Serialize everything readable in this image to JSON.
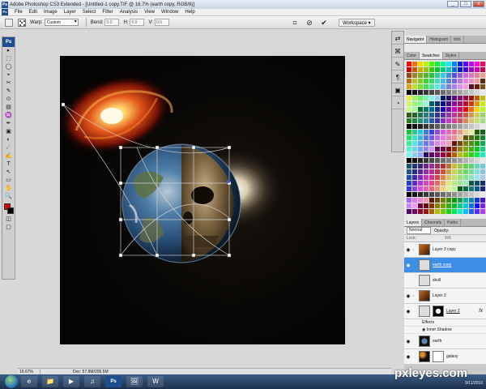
{
  "window": {
    "title": "Adobe Photoshop CS3 Extended - [Untitled-1 copy.TIF @ 16.7% (earth copy, RGB/8)]",
    "minimize": "_",
    "maximize": "□",
    "close": "x"
  },
  "app_logo": "Ps",
  "menu": [
    "File",
    "Edit",
    "Image",
    "Layer",
    "Select",
    "Filter",
    "Analysis",
    "View",
    "Window",
    "Help"
  ],
  "options": {
    "warp_label": "Warp:",
    "warp_value": "Custom",
    "bend_label": "Bend:",
    "bend_value": "0.0",
    "h_label": "H:",
    "h_value": "0.0",
    "v_label": "V:",
    "v_value": "0.0",
    "workspace": "Workspace ▾"
  },
  "tools_head": "Ps",
  "tools": [
    "▸",
    "⬚",
    "◯",
    "⌖",
    "✂",
    "✎",
    "⊙",
    "▤",
    "♒",
    "✒",
    "▣",
    "◐",
    "☄",
    "✍",
    "T",
    "↖",
    "▭",
    "✋",
    "🔍"
  ],
  "status": {
    "zoom": "16.67%",
    "doc": "Doc: 57.8M/205.5M"
  },
  "dock_icons": [
    "⇄",
    "⌘",
    "✎",
    "¶",
    "▣",
    "◔"
  ],
  "panels": {
    "nav_tabs": [
      "Navigator",
      "Histogram",
      "Info"
    ],
    "color_tabs": [
      "Color",
      "Swatches",
      "Styles"
    ],
    "layer_tabs": [
      "Layers",
      "Channels",
      "Paths"
    ],
    "blend_mode": "Normal",
    "opacity_label": "Opacity:",
    "lock_label": "Lock:",
    "fill_label": "Fill:"
  },
  "layers": [
    {
      "name": "Layer 3 copy",
      "selected": false,
      "has_mask": false,
      "fx": false
    },
    {
      "name": "earth copy",
      "selected": true,
      "has_mask": false,
      "fx": false
    },
    {
      "name": "skull",
      "selected": false,
      "has_mask": false,
      "fx": false
    },
    {
      "name": "Layer 3",
      "selected": false,
      "has_mask": false,
      "fx": false
    },
    {
      "name": "Layer 2",
      "selected": false,
      "has_mask": true,
      "fx": true
    }
  ],
  "effects": {
    "label": "Effects",
    "item": "Inner Shadow",
    "fx_badge": "fx"
  },
  "layers_bottom": [
    {
      "name": "earth",
      "has_mask": false
    },
    {
      "name": "galaxy",
      "has_mask": true
    }
  ],
  "taskbar": {
    "tasks": [
      "e",
      "📁",
      "▶",
      "♫",
      "Ps",
      "🖼",
      "W"
    ],
    "date": "9/11/2010"
  },
  "watermark": "pxleyes.com"
}
